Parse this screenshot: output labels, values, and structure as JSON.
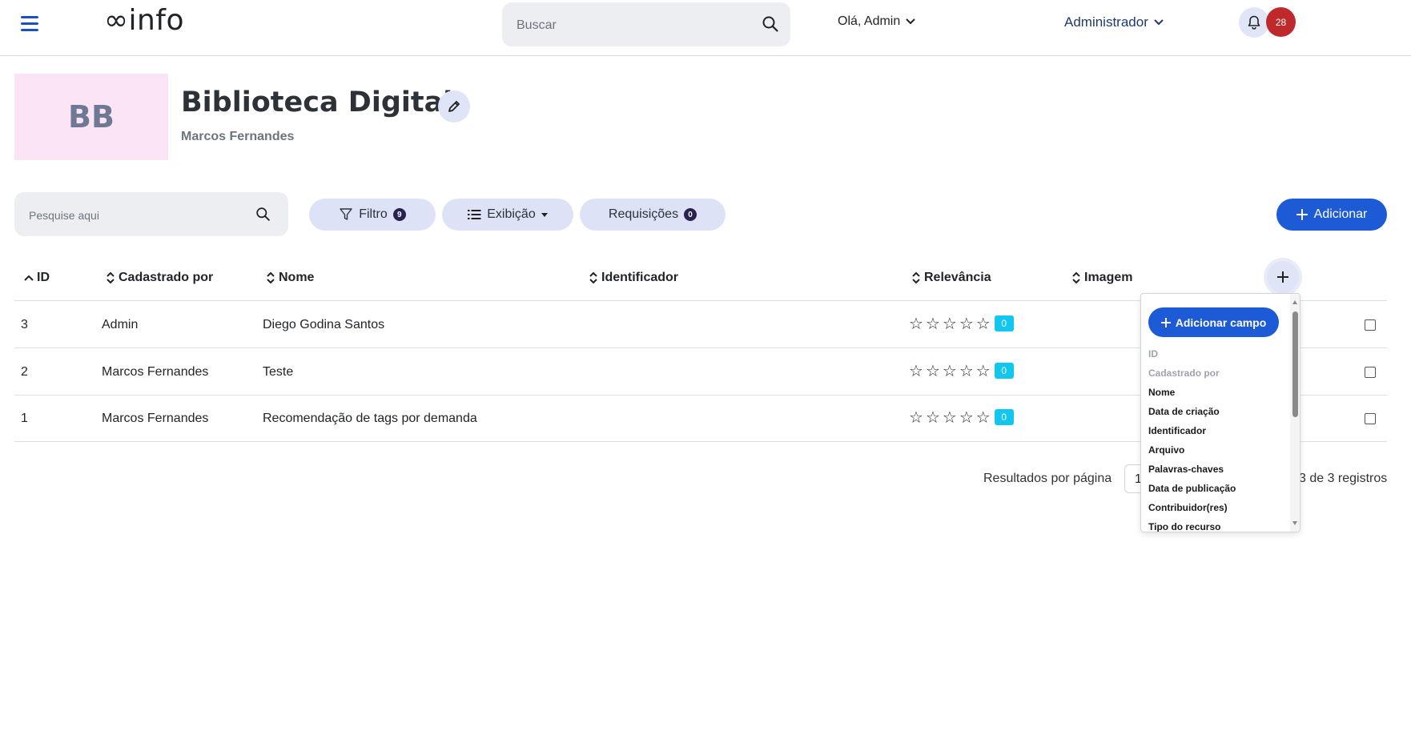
{
  "header": {
    "logo": "∞info",
    "search_placeholder": "Buscar",
    "user_greeting": "Olá, Admin",
    "role": "Administrador",
    "notification_count": "28"
  },
  "collection": {
    "initials": "BB",
    "title": "Biblioteca Digital",
    "author": "Marcos Fernandes"
  },
  "toolbar": {
    "search_placeholder": "Pesquise aqui",
    "filter_label": "Filtro",
    "filter_count": "9",
    "view_label": "Exibição",
    "requests_label": "Requisições",
    "requests_count": "0",
    "add_label": "Adicionar"
  },
  "table": {
    "columns": [
      "ID",
      "Cadastrado por",
      "Nome",
      "Identificador",
      "Relevância",
      "Imagem"
    ],
    "rows": [
      {
        "id": "3",
        "by": "Admin",
        "name": "Diego Godina Santos",
        "relevance": "0"
      },
      {
        "id": "2",
        "by": "Marcos Fernandes",
        "name": "Teste",
        "relevance": "0"
      },
      {
        "id": "1",
        "by": "Marcos Fernandes",
        "name": "Recomendação de tags por demanda",
        "relevance": "0"
      }
    ],
    "star_rating": 0,
    "star_max": 5
  },
  "footer": {
    "per_page_label": "Resultados por página",
    "per_page_value": "1",
    "records": "3 de 3 registros"
  },
  "field_dropdown": {
    "add_label": "Adicionar campo",
    "items": [
      {
        "label": "ID",
        "disabled": true
      },
      {
        "label": "Cadastrado por",
        "disabled": true
      },
      {
        "label": "Nome",
        "disabled": false
      },
      {
        "label": "Data de criação",
        "disabled": false
      },
      {
        "label": "Identificador",
        "disabled": false
      },
      {
        "label": "Arquivo",
        "disabled": false
      },
      {
        "label": "Palavras-chaves",
        "disabled": false
      },
      {
        "label": "Data de publicação",
        "disabled": false
      },
      {
        "label": "Contribuidor(res)",
        "disabled": false
      },
      {
        "label": "Tipo do recurso",
        "disabled": false
      }
    ]
  },
  "colors": {
    "primary": "#1c5ad6",
    "pill_bg": "#dde2f6",
    "badge_red": "#c0292b",
    "relevance_badge": "#11c6ef"
  }
}
